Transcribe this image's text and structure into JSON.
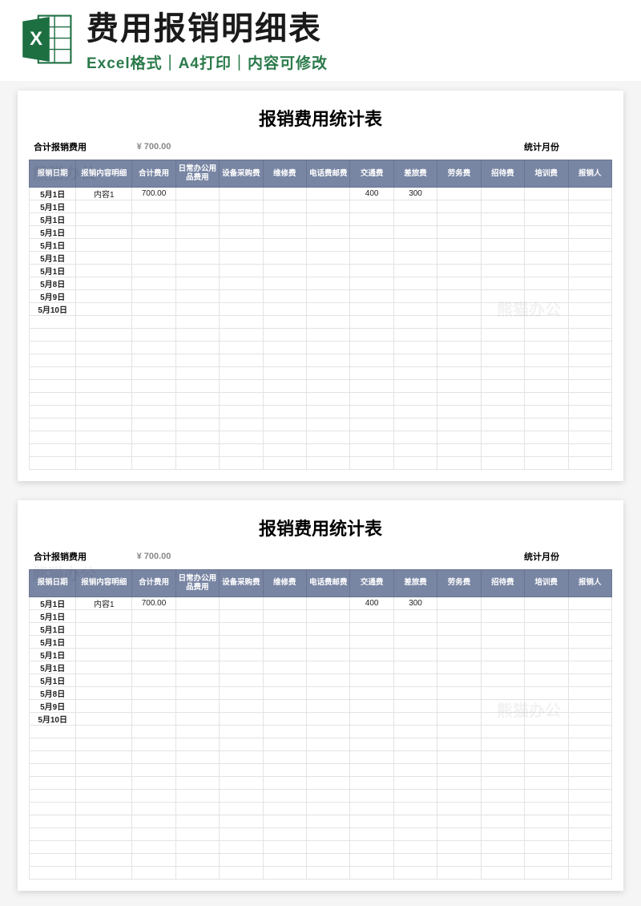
{
  "header": {
    "main_title": "费用报销明细表",
    "sub_title": "Excel格式｜A4打印｜内容可修改",
    "icon_letter": "X"
  },
  "sheet": {
    "title": "报销费用统计表",
    "summary": {
      "total_label": "合计报销费用",
      "total_value": "¥ 700.00",
      "month_label": "统计月份",
      "month_value": ""
    },
    "columns": [
      "报销日期",
      "报销内容明细",
      "合计费用",
      "日常办公用品费用",
      "设备采购费",
      "维修费",
      "电话费邮费",
      "交通费",
      "差旅费",
      "劳务费",
      "招待费",
      "培训费",
      "报销人"
    ],
    "rows": [
      {
        "date": "5月1日",
        "content": "内容1",
        "total": "700.00",
        "c4": "",
        "c5": "",
        "c6": "",
        "c7": "",
        "c8": "400",
        "c9": "300",
        "c10": "",
        "c11": "",
        "c12": "",
        "c13": ""
      },
      {
        "date": "5月1日",
        "content": "",
        "total": "",
        "c4": "",
        "c5": "",
        "c6": "",
        "c7": "",
        "c8": "",
        "c9": "",
        "c10": "",
        "c11": "",
        "c12": "",
        "c13": ""
      },
      {
        "date": "5月1日",
        "content": "",
        "total": "",
        "c4": "",
        "c5": "",
        "c6": "",
        "c7": "",
        "c8": "",
        "c9": "",
        "c10": "",
        "c11": "",
        "c12": "",
        "c13": ""
      },
      {
        "date": "5月1日",
        "content": "",
        "total": "",
        "c4": "",
        "c5": "",
        "c6": "",
        "c7": "",
        "c8": "",
        "c9": "",
        "c10": "",
        "c11": "",
        "c12": "",
        "c13": ""
      },
      {
        "date": "5月1日",
        "content": "",
        "total": "",
        "c4": "",
        "c5": "",
        "c6": "",
        "c7": "",
        "c8": "",
        "c9": "",
        "c10": "",
        "c11": "",
        "c12": "",
        "c13": ""
      },
      {
        "date": "5月1日",
        "content": "",
        "total": "",
        "c4": "",
        "c5": "",
        "c6": "",
        "c7": "",
        "c8": "",
        "c9": "",
        "c10": "",
        "c11": "",
        "c12": "",
        "c13": ""
      },
      {
        "date": "5月1日",
        "content": "",
        "total": "",
        "c4": "",
        "c5": "",
        "c6": "",
        "c7": "",
        "c8": "",
        "c9": "",
        "c10": "",
        "c11": "",
        "c12": "",
        "c13": ""
      },
      {
        "date": "5月8日",
        "content": "",
        "total": "",
        "c4": "",
        "c5": "",
        "c6": "",
        "c7": "",
        "c8": "",
        "c9": "",
        "c10": "",
        "c11": "",
        "c12": "",
        "c13": ""
      },
      {
        "date": "5月9日",
        "content": "",
        "total": "",
        "c4": "",
        "c5": "",
        "c6": "",
        "c7": "",
        "c8": "",
        "c9": "",
        "c10": "",
        "c11": "",
        "c12": "",
        "c13": ""
      },
      {
        "date": "5月10日",
        "content": "",
        "total": "",
        "c4": "",
        "c5": "",
        "c6": "",
        "c7": "",
        "c8": "",
        "c9": "",
        "c10": "",
        "c11": "",
        "c12": "",
        "c13": ""
      }
    ],
    "empty_rows": 12
  },
  "watermark_text": "熊猫办公"
}
